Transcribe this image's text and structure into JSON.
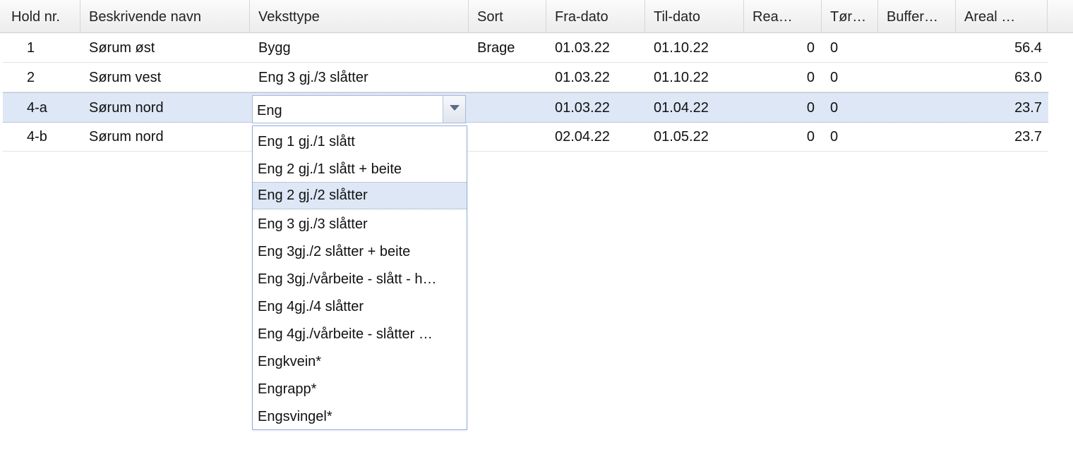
{
  "columns": [
    "Hold nr.",
    "Beskrivende navn",
    "Veksttype",
    "Sort",
    "Fra-dato",
    "Til-dato",
    "Rea…",
    "Tør…",
    "Buffer…",
    "Areal …"
  ],
  "rows": [
    {
      "hold": "1",
      "navn": "Sørum øst",
      "veksttype": "Bygg",
      "sort": "Brage",
      "fra": "01.03.22",
      "til": "01.10.22",
      "rea": "0",
      "tor": "0",
      "buffer": "",
      "areal": "56.4"
    },
    {
      "hold": "2",
      "navn": "Sørum vest",
      "veksttype": "Eng 3 gj./3 slåtter",
      "sort": "",
      "fra": "01.03.22",
      "til": "01.10.22",
      "rea": "0",
      "tor": "0",
      "buffer": "",
      "areal": "63.0"
    },
    {
      "hold": "4-a",
      "navn": "Sørum nord",
      "veksttype": "",
      "sort": "",
      "fra": "01.03.22",
      "til": "01.04.22",
      "rea": "0",
      "tor": "0",
      "buffer": "",
      "areal": "23.7"
    },
    {
      "hold": "4-b",
      "navn": "Sørum nord",
      "veksttype": "",
      "sort": "",
      "fra": "02.04.22",
      "til": "01.05.22",
      "rea": "0",
      "tor": "0",
      "buffer": "",
      "areal": "23.7"
    }
  ],
  "editor": {
    "value": "Eng",
    "icon": "chevron-down-icon"
  },
  "dropdown": {
    "options": [
      "Eng 1 gj./1 slått",
      "Eng 2 gj./1 slått + beite",
      "Eng 2 gj./2 slåtter",
      "Eng 3 gj./3 slåtter",
      "Eng 3gj./2 slåtter + beite",
      "Eng 3gj./vårbeite - slått - h…",
      "Eng 4gj./4 slåtter",
      "Eng 4gj./vårbeite - slåtter …",
      "Engkvein*",
      "Engrapp*",
      "Engsvingel*"
    ],
    "highlighted": "Eng 2 gj./2 slåtter"
  },
  "colors": {
    "selection": "#dde7f6",
    "dropdown_border": "#8fb0dc"
  }
}
